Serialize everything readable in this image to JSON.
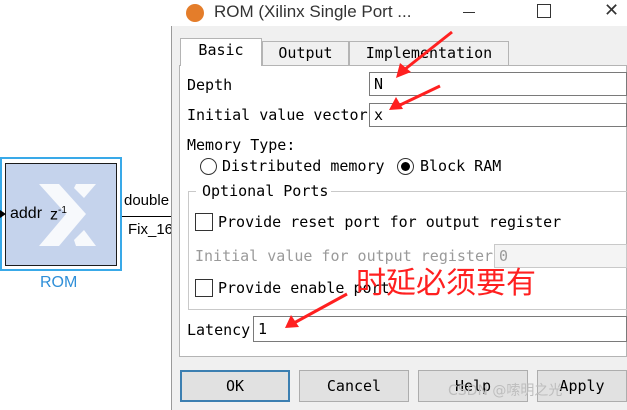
{
  "model": {
    "block": {
      "input_label": "addr",
      "delay_label": "z",
      "delay_exponent": "-1",
      "name": "ROM",
      "output_type": "double",
      "output_fixed_type": "Fix_16"
    }
  },
  "dialog": {
    "title": "ROM (Xilinx Single Port ...",
    "tabs": [
      {
        "label": "Basic",
        "active": true
      },
      {
        "label": "Output",
        "active": false
      },
      {
        "label": "Implementation",
        "active": false
      }
    ],
    "depth": {
      "label": "Depth",
      "value": "N"
    },
    "initial_value_vector": {
      "label": "Initial value vector",
      "value": "x"
    },
    "memory_type": {
      "label": "Memory Type:",
      "options": [
        {
          "label": "Distributed memory",
          "selected": false
        },
        {
          "label": "Block RAM",
          "selected": true
        }
      ]
    },
    "optional_ports": {
      "label": "Optional Ports",
      "reset_port": {
        "label": "Provide reset port for output register",
        "checked": false
      },
      "initial_value_output_register": {
        "label": "Initial value for output register",
        "value": "0",
        "enabled": false
      },
      "enable_port": {
        "label": "Provide enable port",
        "checked": false
      }
    },
    "latency": {
      "label": "Latency",
      "value": "1"
    },
    "buttons": {
      "ok": "OK",
      "cancel": "Cancel",
      "help": "Help",
      "apply": "Apply"
    }
  },
  "annotation": {
    "text": "时延必须要有",
    "color": "#ff2020"
  },
  "watermark": "CSDN @嗦明之光",
  "colors": {
    "block_selection": "#39a9e8",
    "block_fill": "#c5d3ec",
    "accent": "#3c7fb1"
  }
}
